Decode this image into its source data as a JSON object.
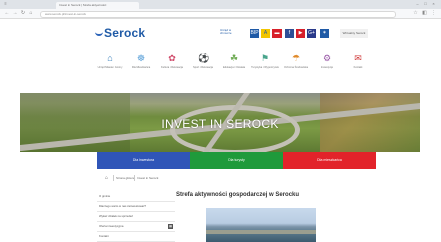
{
  "browser": {
    "tab_title": "Invest in Serock | Strefa aktywności",
    "url": "www.serock.pl/invest-in-serock",
    "nav_back": "←",
    "nav_forward": "→",
    "nav_reload": "↻",
    "nav_home": "⌂"
  },
  "header": {
    "logo_text": "Serock",
    "cloud_line1": "Urząd w",
    "cloud_line2": "chmurze",
    "qr_label": "Wirtualny Serock",
    "social": [
      "BIP",
      "A",
      "f",
      "▶",
      "G+"
    ]
  },
  "nav": {
    "items": [
      {
        "icon": "⌂",
        "label": "Urząd Miasta i Gminy"
      },
      {
        "icon": "☸",
        "label": "Dla Mieszkańca"
      },
      {
        "icon": "✿",
        "label": "Kultura i Rekreacja"
      },
      {
        "icon": "⚽",
        "label": "Sport i Rekreacja"
      },
      {
        "icon": "☘",
        "label": "Edukacja i Oświata"
      },
      {
        "icon": "⚑",
        "label": "Turystyka i Wypoczynek"
      },
      {
        "icon": "☂",
        "label": "Ochrona Środowiska"
      },
      {
        "icon": "⚙",
        "label": "Inwestycje"
      },
      {
        "icon": "✉",
        "label": "Kontakt"
      }
    ]
  },
  "hero": {
    "title": "INVEST IN SEROCK"
  },
  "cta": {
    "blue": "Dla inwestora",
    "green": "Dla turysty",
    "red": "Dla mieszkańca"
  },
  "breadcrumb": {
    "crumb1": "Strona główna",
    "crumb2": "Invest in Serock"
  },
  "sidebar": {
    "items": [
      {
        "label": "O gminie"
      },
      {
        "label": "Dlaczego warto w nas zainwestować?"
      },
      {
        "label": "Wykaz działek na sprzedaż"
      },
      {
        "label": "Oferta inwestycyjna",
        "badge": "▦"
      },
      {
        "label": "Kontakt"
      }
    ]
  },
  "content": {
    "title": "Strefa aktywności gospodarczej w Serocku"
  },
  "colors": {
    "blue": "#2f55b8",
    "green": "#1f9a3b",
    "red": "#e2232a"
  }
}
